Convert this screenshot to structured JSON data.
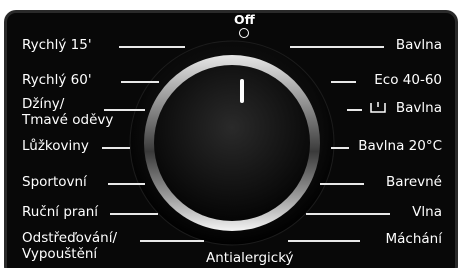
{
  "selector": {
    "off_label": "Off",
    "programs_left": [
      "Rychlý 15'",
      "Rychlý 60'",
      "Džíny/",
      "Tmavé oděvy",
      "Lůžkoviny",
      "Sportovní",
      "Ruční praní",
      "Odstřeďování/",
      "Vypouštění"
    ],
    "programs_right": [
      "Bavlna",
      "Eco 40-60",
      "Bavlna",
      "Bavlna 20°C",
      "Barevné",
      "Vlna",
      "Máchání"
    ],
    "bottom_program": "Antialergický",
    "icons": {
      "cotton_program_icon": "basin-icon",
      "off_position_icon": "circle-icon"
    },
    "colors": {
      "panel": "#080808",
      "text": "#ffffff",
      "knob_ring": "#c8c8c8"
    }
  }
}
